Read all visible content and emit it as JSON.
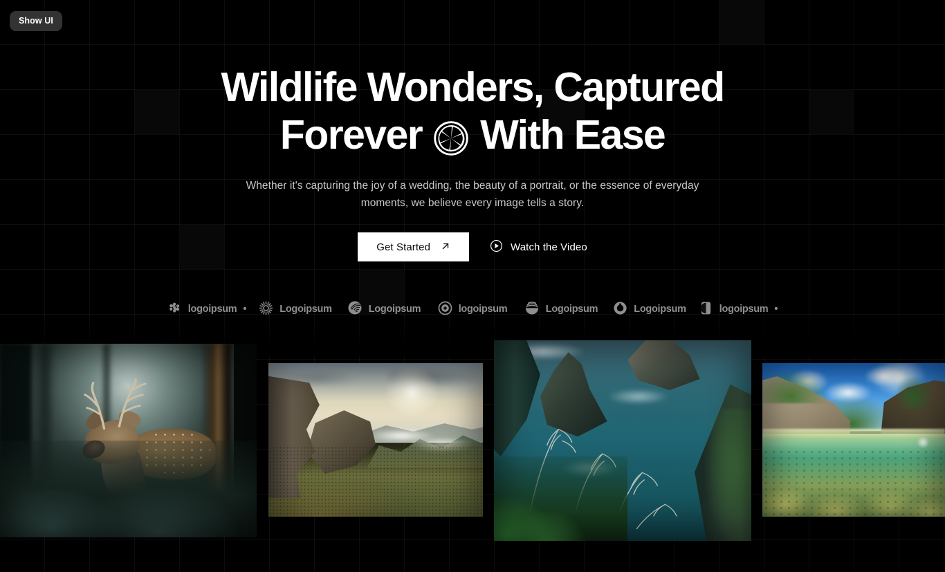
{
  "overlay": {
    "show_ui_label": "Show UI"
  },
  "hero": {
    "headline_line1": "Wildlife Wonders, Captured",
    "headline_line2_before": "Forever",
    "headline_icon": "aperture-icon",
    "headline_line2_after": "With Ease",
    "subtitle": "Whether it's capturing the joy of a wedding, the beauty of a portrait, or the essence of everyday moments, we believe every image tells a story.",
    "primary_cta": {
      "label": "Get Started",
      "icon": "arrow-up-right-icon"
    },
    "secondary_cta": {
      "label": "Watch the Video",
      "icon": "play-circle-icon"
    }
  },
  "logos": [
    {
      "name": "Logoipsum",
      "text": "logoipsum",
      "trademark": "•",
      "icon": "dots-pattern-icon",
      "weight": "normal"
    },
    {
      "name": "Logoipsum",
      "text": "Logoipsum",
      "trademark": "",
      "icon": "sunburst-icon",
      "weight": "bold"
    },
    {
      "name": "Logoipsum",
      "text": "Logoipsum",
      "trademark": "",
      "icon": "spiral-icon",
      "weight": "bold"
    },
    {
      "name": "Logoipsum",
      "text": "logoipsum",
      "trademark": "",
      "icon": "target-circle-icon",
      "weight": "bold"
    },
    {
      "name": "Logoipsum",
      "text": "Logoipsum",
      "trademark": "",
      "icon": "wave-bowl-icon",
      "weight": "bold"
    },
    {
      "name": "Logoipsum",
      "text": "Logoipsum",
      "trademark": "",
      "icon": "ring-blob-icon",
      "weight": "bold"
    },
    {
      "name": "Logoipsum",
      "text": "logoipsum",
      "trademark": "•",
      "icon": "half-moon-square-icon",
      "weight": "normal"
    }
  ],
  "gallery": [
    {
      "alt": "Spotted deer resting in a misty green forest"
    },
    {
      "alt": "Sunlit mountain ridges with low clouds over a valley"
    },
    {
      "alt": "Teal ocean cove with rocky sea stacks and foreground grasses"
    },
    {
      "alt": "Over-under split view of a coastal reef under a blue sky"
    }
  ],
  "theme": {
    "background": "#000000",
    "text_primary": "#ffffff",
    "text_muted": "#c9c9c9",
    "accent_button_bg": "#ffffff",
    "accent_button_text": "#0a0a0a",
    "pill_bg": "#333333",
    "logo_color": "#a9a9a9"
  }
}
